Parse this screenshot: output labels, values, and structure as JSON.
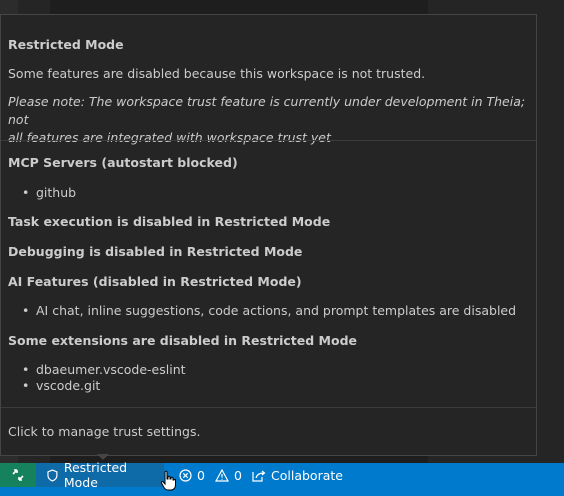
{
  "hover": {
    "title": "Restricted Mode",
    "description": "Some features are disabled because this workspace is not trusted.",
    "note_line1": "Please note: The workspace trust feature is currently under development in Theia; not",
    "note_line2": "all features are integrated with workspace trust yet",
    "mcp_heading": "MCP Servers (autostart blocked)",
    "mcp_items": [
      "github"
    ],
    "task_heading": "Task execution is disabled in Restricted Mode",
    "debug_heading": "Debugging is disabled in Restricted Mode",
    "ai_heading": "AI Features (disabled in Restricted Mode)",
    "ai_items": [
      "AI chat, inline suggestions, code actions, and prompt templates are disabled"
    ],
    "ext_heading": "Some extensions are disabled in Restricted Mode",
    "ext_items": [
      "dbaeumer.vscode-eslint",
      "vscode.git"
    ],
    "footer": "Click to manage trust settings."
  },
  "statusbar": {
    "restricted_label": "Restricted Mode",
    "errors": "0",
    "warnings": "0",
    "collaborate_label": "Collaborate"
  },
  "colors": {
    "statusbar_bg": "#007acc",
    "remote_bg": "#16825d",
    "hover_bg": "#252526"
  },
  "icons": [
    "remote-icon",
    "shield-icon",
    "error-icon",
    "warning-icon",
    "collaborate-icon",
    "hand-cursor-icon"
  ]
}
